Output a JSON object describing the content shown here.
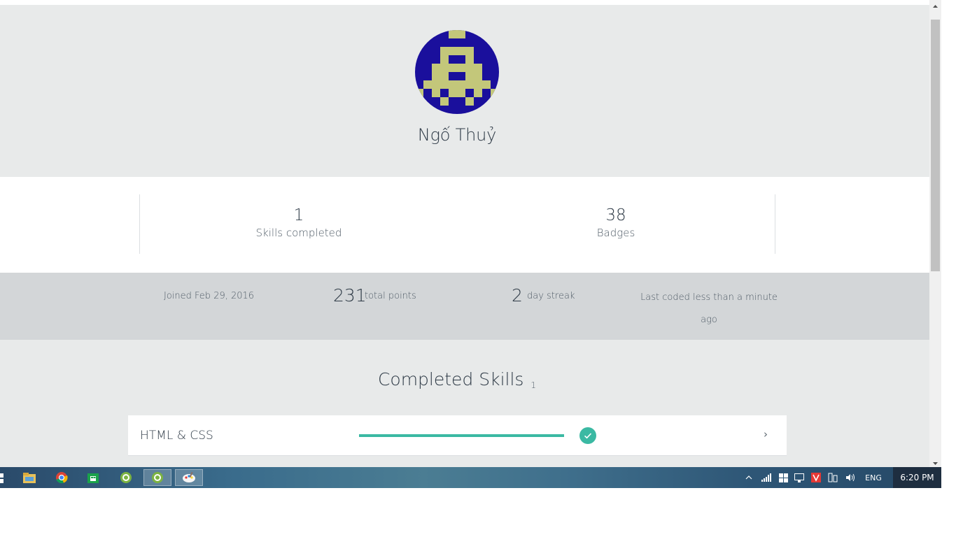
{
  "profile": {
    "name": "Ngố Thuỷ",
    "avatar_colors": {
      "background": "#1a0f9c",
      "pattern": "#c3c77a"
    }
  },
  "stats": {
    "skills_completed": {
      "value": "1",
      "label": "Skills completed"
    },
    "badges": {
      "value": "38",
      "label": "Badges"
    }
  },
  "info": {
    "joined": "Joined Feb 29, 2016",
    "points_value": "231",
    "points_label": "total points",
    "streak_value": "2",
    "streak_label": "day streak",
    "last_coded": "Last coded less than a minute ago"
  },
  "completed_skills": {
    "title": "Completed Skills",
    "count": "1",
    "items": [
      {
        "name": "HTML & CSS",
        "progress": 1.0,
        "status": "completed",
        "status_icon": "check-icon"
      }
    ]
  },
  "taskbar": {
    "icons": [
      "start-icon",
      "file-explorer-icon",
      "chrome-icon",
      "store-icon",
      "app-icon",
      "app-icon-active",
      "paint-icon"
    ],
    "tray": {
      "language": "ENG",
      "time": "6:20 PM",
      "icons": [
        "show-hidden-icon",
        "network-icon",
        "windows-flag-icon",
        "display-icon",
        "vivaldi-icon",
        "device-icon",
        "volume-icon"
      ]
    }
  },
  "colors": {
    "accent": "#3bb9a3",
    "header_bg": "#e8eaea",
    "info_bg": "#d3d6d8",
    "text": "#2e3a46"
  }
}
